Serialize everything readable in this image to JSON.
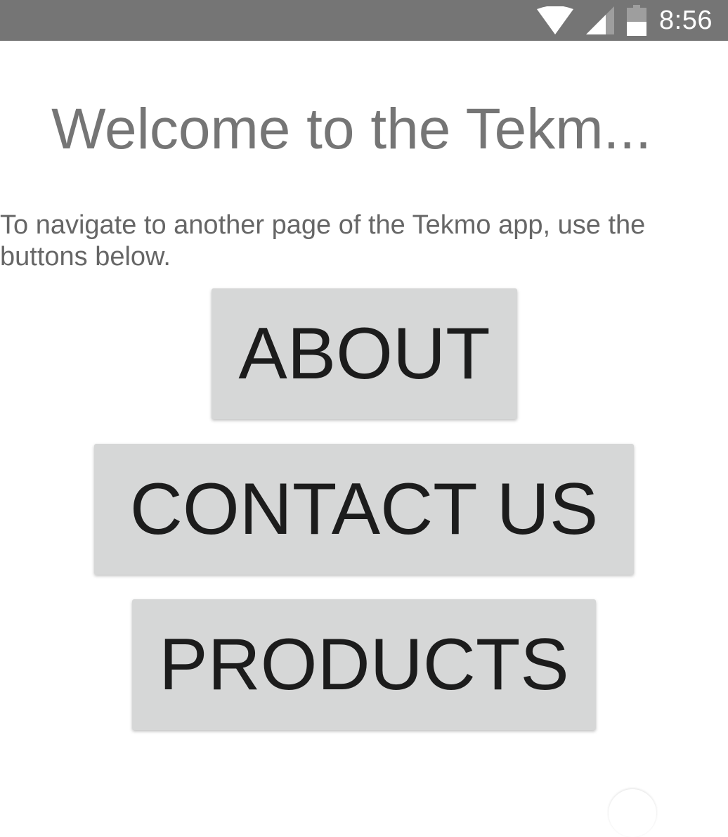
{
  "status_bar": {
    "time": "8:56",
    "icons": [
      "wifi-icon",
      "cellular-signal-icon",
      "battery-icon"
    ],
    "background": "#757575"
  },
  "page": {
    "title": "Welcome to the Tekm...",
    "description": "To navigate to another page of the Tekmo app, use the buttons below."
  },
  "buttons": {
    "about": "ABOUT",
    "contact": "CONTACT US",
    "products": "PRODUCTS"
  },
  "colors": {
    "button_bg": "#d6d7d7",
    "button_text": "#1c1c1c",
    "title_text": "#757575",
    "body_text": "#666666"
  }
}
